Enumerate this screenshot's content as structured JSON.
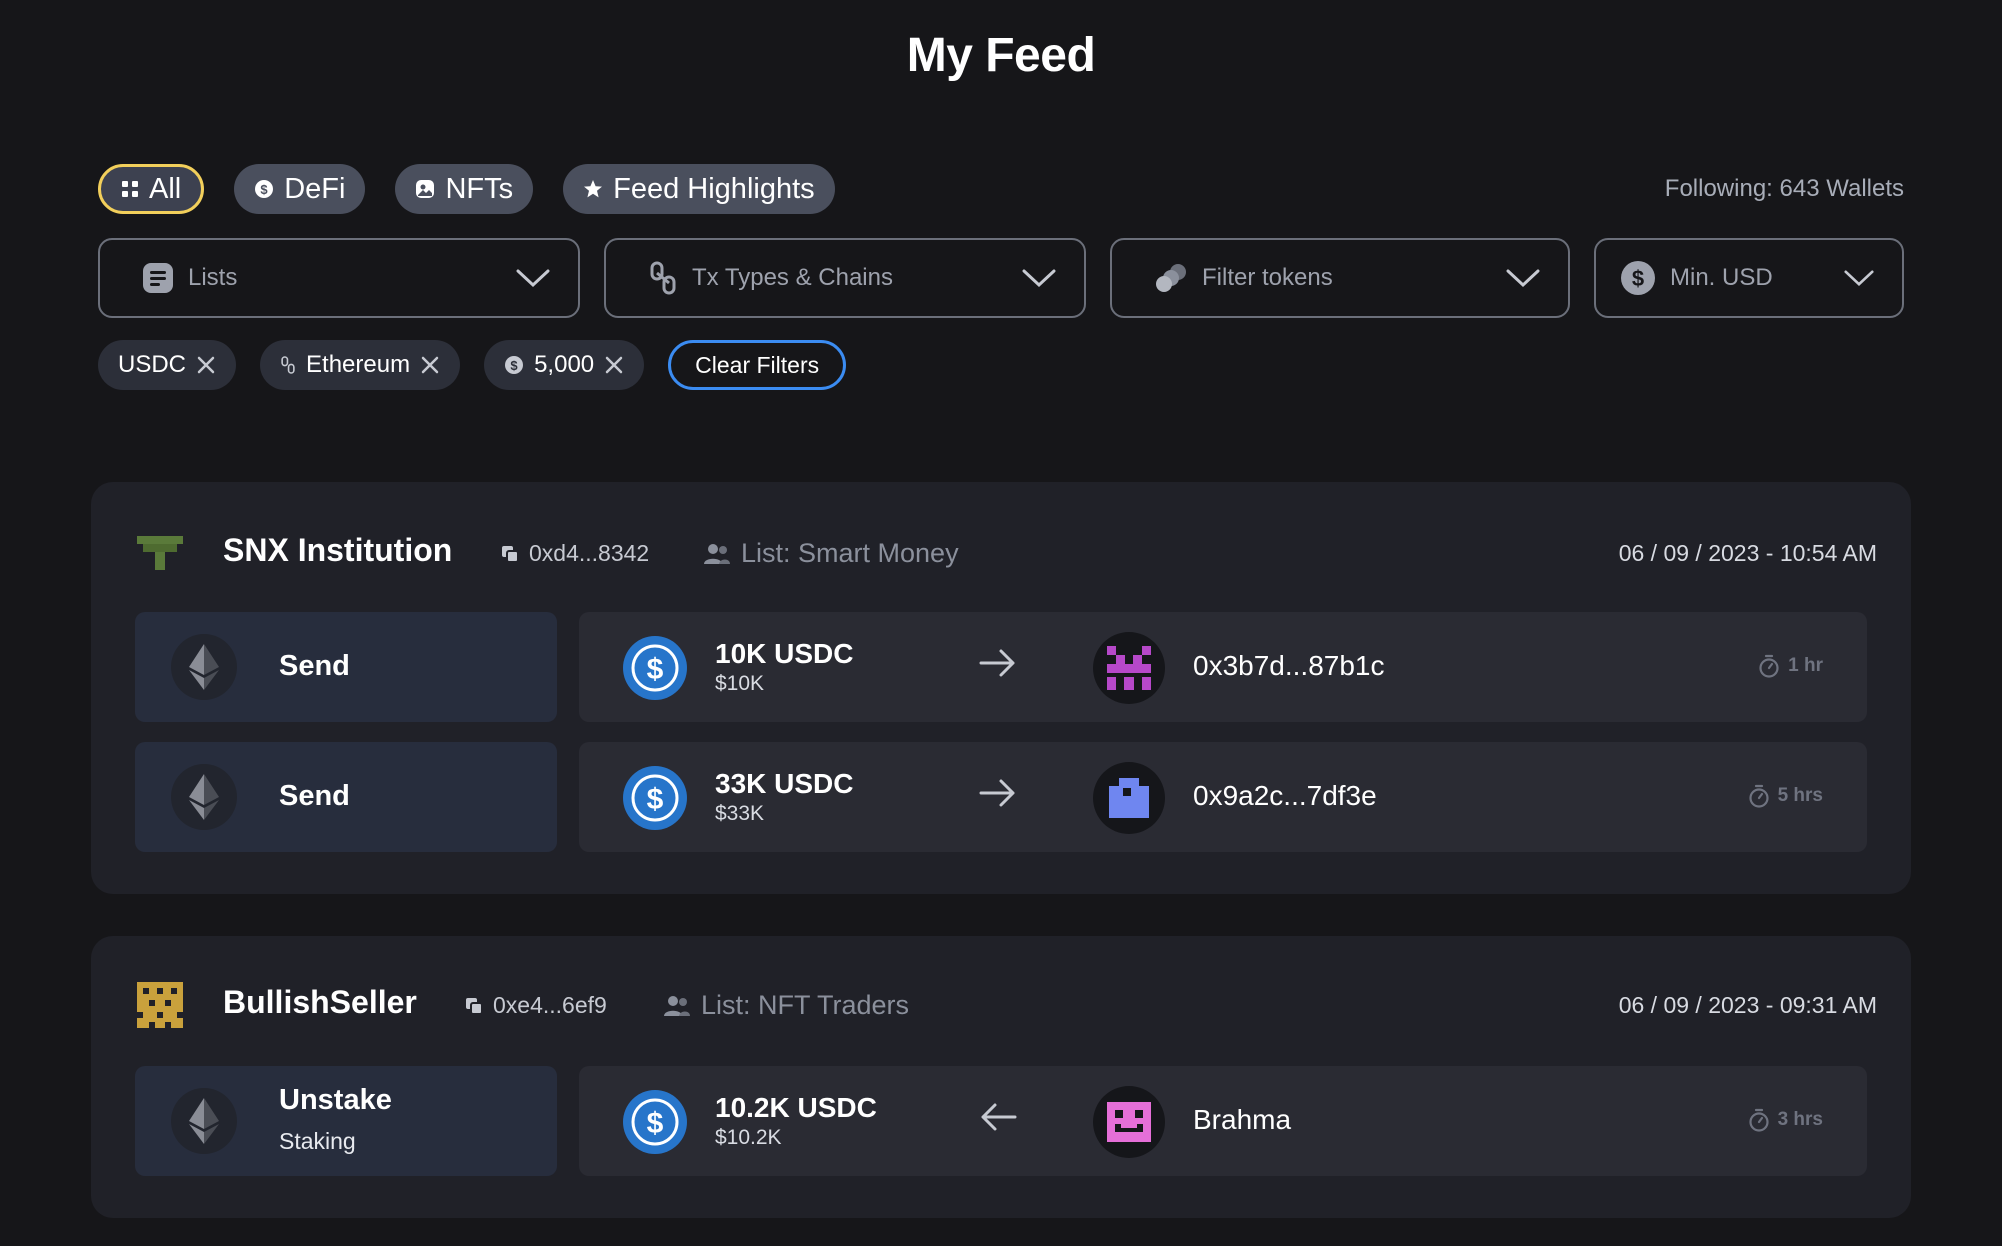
{
  "page": {
    "title": "My Feed"
  },
  "tabs": [
    {
      "label": "All",
      "icon": "grid-icon",
      "active": true
    },
    {
      "label": "DeFi",
      "icon": "dollar-coin-icon",
      "active": false
    },
    {
      "label": "NFTs",
      "icon": "image-icon",
      "active": false
    },
    {
      "label": "Feed Highlights",
      "icon": "star-icon",
      "active": false
    }
  ],
  "following": "Following: 643 Wallets",
  "filters": {
    "lists": "Lists",
    "tx_types": "Tx Types & Chains",
    "tokens": "Filter tokens",
    "min_usd": "Min. USD"
  },
  "chips": {
    "token": "USDC",
    "chain": "Ethereum",
    "amount": "5,000",
    "clear": "Clear Filters"
  },
  "colors": {
    "accent_tab_border": "#f2cf5b",
    "clear_button_border": "#3b8cf2",
    "usdc_blue": "#2775ca"
  },
  "cards": [
    {
      "name": "SNX Institution",
      "address": "0xd4...8342",
      "list": "List: Smart Money",
      "date": "06 / 09 / 2023 - 10:54 AM",
      "rows": [
        {
          "action": "Send",
          "sub": "",
          "amount": "10K USDC",
          "usd": "$10K",
          "direction": "out",
          "counterparty": "0x3b7d...87b1c",
          "time": "1 hr"
        },
        {
          "action": "Send",
          "sub": "",
          "amount": "33K USDC",
          "usd": "$33K",
          "direction": "out",
          "counterparty": "0x9a2c...7df3e",
          "time": "5 hrs"
        }
      ]
    },
    {
      "name": "BullishSeller",
      "address": "0xe4...6ef9",
      "list": "List: NFT Traders",
      "date": "06 / 09 / 2023 - 09:31 AM",
      "rows": [
        {
          "action": "Unstake",
          "sub": "Staking",
          "amount": "10.2K USDC",
          "usd": "$10.2K",
          "direction": "in",
          "counterparty": "Brahma",
          "time": "3 hrs"
        }
      ]
    }
  ]
}
